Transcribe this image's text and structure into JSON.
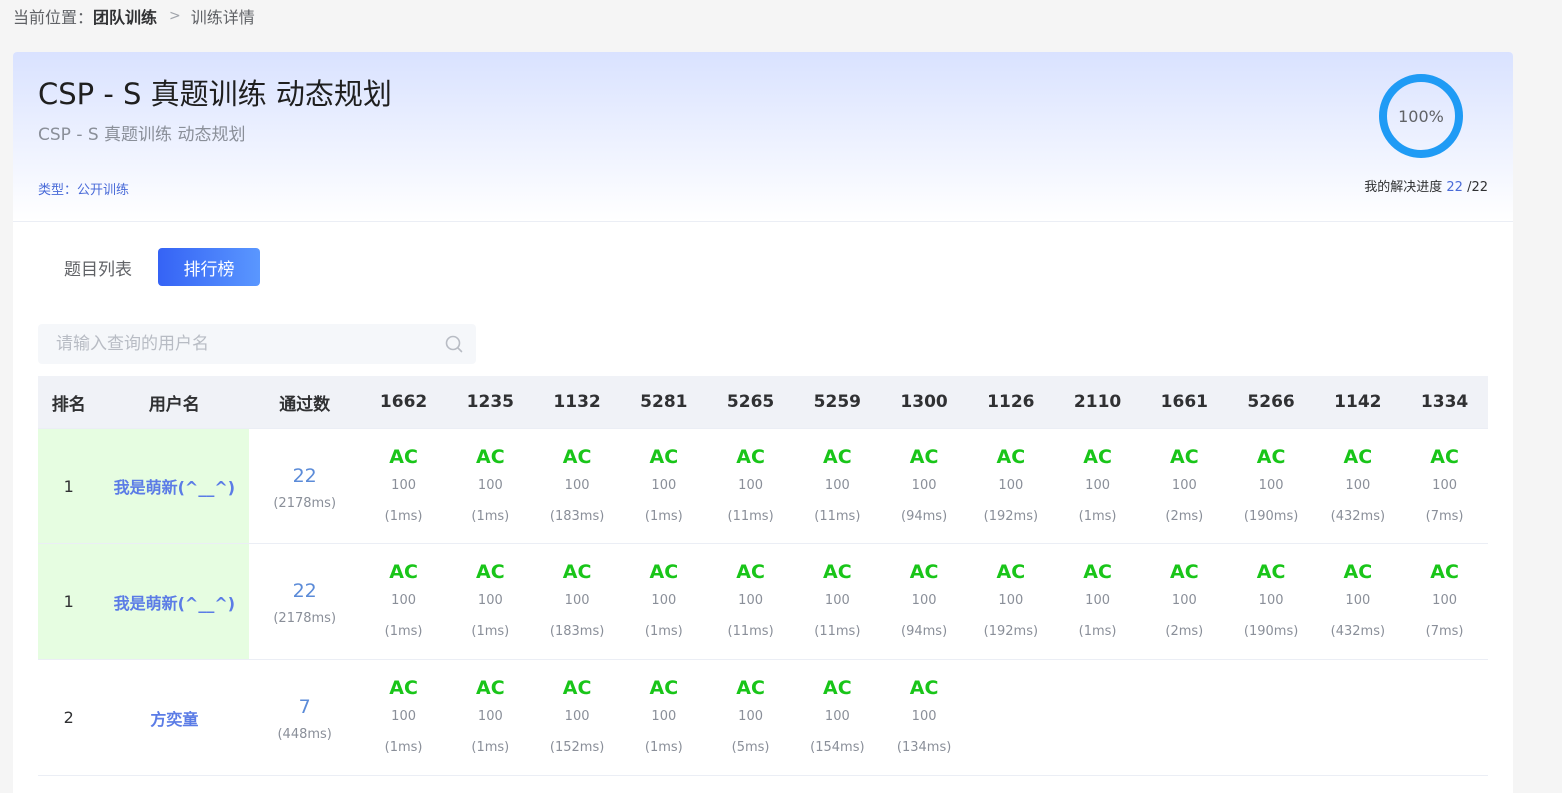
{
  "breadcrumb": {
    "prefix": "当前位置：",
    "current": "团队训练",
    "separator": ">",
    "leaf": "训练详情"
  },
  "header": {
    "title": "CSP - S 真题训练 动态规划",
    "subtitle": "CSP - S 真题训练 动态规划",
    "type_label": "类型：",
    "type_value": "公开训练",
    "progress_percent": 100,
    "progress_label": "100%",
    "progress_text": "我的解决进度",
    "solved": "22",
    "total": "/22"
  },
  "tabs": [
    {
      "label": "题目列表",
      "active": false
    },
    {
      "label": "排行榜",
      "active": true
    }
  ],
  "search": {
    "placeholder": "请输入查询的用户名",
    "value": ""
  },
  "table": {
    "headers": {
      "rank": "排名",
      "user": "用户名",
      "pass": "通过数",
      "problems": [
        "1662",
        "1235",
        "1132",
        "5281",
        "5265",
        "5259",
        "1300",
        "1126",
        "2110",
        "1661",
        "5266",
        "1142",
        "1334"
      ]
    },
    "rows": [
      {
        "rank": "1",
        "user": "我是萌新(^__^)",
        "pass": "22",
        "time": "(2178ms)",
        "highlight": true,
        "results": [
          {
            "status": "AC",
            "score": "100",
            "time": "(1ms)"
          },
          {
            "status": "AC",
            "score": "100",
            "time": "(1ms)"
          },
          {
            "status": "AC",
            "score": "100",
            "time": "(183ms)"
          },
          {
            "status": "AC",
            "score": "100",
            "time": "(1ms)"
          },
          {
            "status": "AC",
            "score": "100",
            "time": "(11ms)"
          },
          {
            "status": "AC",
            "score": "100",
            "time": "(11ms)"
          },
          {
            "status": "AC",
            "score": "100",
            "time": "(94ms)"
          },
          {
            "status": "AC",
            "score": "100",
            "time": "(192ms)"
          },
          {
            "status": "AC",
            "score": "100",
            "time": "(1ms)"
          },
          {
            "status": "AC",
            "score": "100",
            "time": "(2ms)"
          },
          {
            "status": "AC",
            "score": "100",
            "time": "(190ms)"
          },
          {
            "status": "AC",
            "score": "100",
            "time": "(432ms)"
          },
          {
            "status": "AC",
            "score": "100",
            "time": "(7ms)"
          }
        ]
      },
      {
        "rank": "1",
        "user": "我是萌新(^__^)",
        "pass": "22",
        "time": "(2178ms)",
        "highlight": true,
        "results": [
          {
            "status": "AC",
            "score": "100",
            "time": "(1ms)"
          },
          {
            "status": "AC",
            "score": "100",
            "time": "(1ms)"
          },
          {
            "status": "AC",
            "score": "100",
            "time": "(183ms)"
          },
          {
            "status": "AC",
            "score": "100",
            "time": "(1ms)"
          },
          {
            "status": "AC",
            "score": "100",
            "time": "(11ms)"
          },
          {
            "status": "AC",
            "score": "100",
            "time": "(11ms)"
          },
          {
            "status": "AC",
            "score": "100",
            "time": "(94ms)"
          },
          {
            "status": "AC",
            "score": "100",
            "time": "(192ms)"
          },
          {
            "status": "AC",
            "score": "100",
            "time": "(1ms)"
          },
          {
            "status": "AC",
            "score": "100",
            "time": "(2ms)"
          },
          {
            "status": "AC",
            "score": "100",
            "time": "(190ms)"
          },
          {
            "status": "AC",
            "score": "100",
            "time": "(432ms)"
          },
          {
            "status": "AC",
            "score": "100",
            "time": "(7ms)"
          }
        ]
      },
      {
        "rank": "2",
        "user": "方奕童",
        "pass": "7",
        "time": "(448ms)",
        "highlight": false,
        "results": [
          {
            "status": "AC",
            "score": "100",
            "time": "(1ms)"
          },
          {
            "status": "AC",
            "score": "100",
            "time": "(1ms)"
          },
          {
            "status": "AC",
            "score": "100",
            "time": "(152ms)"
          },
          {
            "status": "AC",
            "score": "100",
            "time": "(1ms)"
          },
          {
            "status": "AC",
            "score": "100",
            "time": "(5ms)"
          },
          {
            "status": "AC",
            "score": "100",
            "time": "(154ms)"
          },
          {
            "status": "AC",
            "score": "100",
            "time": "(134ms)"
          }
        ]
      }
    ]
  },
  "colors": {
    "accent": "#3563f5",
    "ac_green": "#19c519",
    "user_blue": "#5b7ce6",
    "highlight_bg": "#e6fde1",
    "ring": "#1f9bf5"
  }
}
